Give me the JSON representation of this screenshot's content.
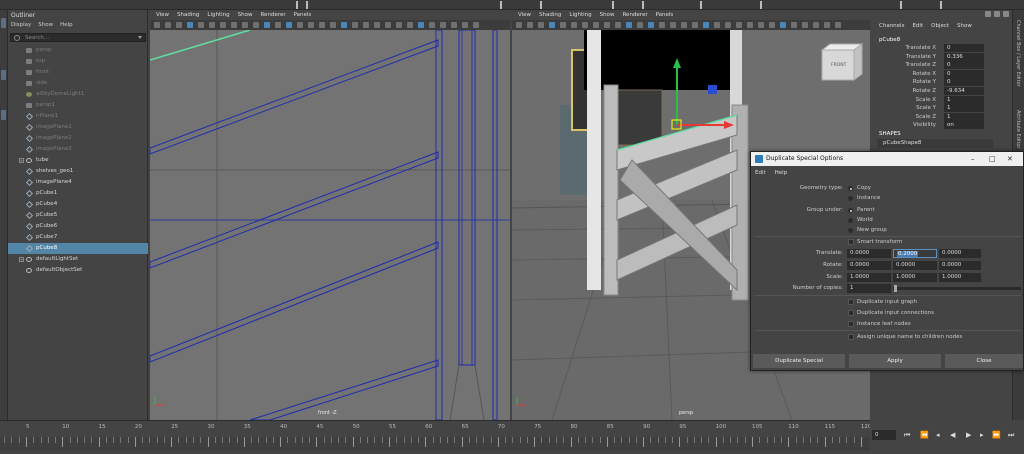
{
  "outliner": {
    "title": "Outliner",
    "menu": [
      "Display",
      "Show",
      "Help"
    ],
    "search_placeholder": "Search...",
    "items": [
      {
        "label": "persp",
        "icon": "camera-icon",
        "dim": true
      },
      {
        "label": "top",
        "icon": "camera-icon",
        "dim": true
      },
      {
        "label": "front",
        "icon": "camera-icon",
        "dim": true
      },
      {
        "label": "side",
        "icon": "camera-icon",
        "dim": true
      },
      {
        "label": "aiSkyDomeLight1",
        "icon": "light-icon",
        "dim": true
      },
      {
        "label": "persp1",
        "icon": "camera-icon",
        "dim": true
      },
      {
        "label": "nPlane1",
        "icon": "mesh-icon",
        "dim": true
      },
      {
        "label": "imagePlane1",
        "icon": "mesh-icon",
        "dim": true
      },
      {
        "label": "imagePlane2",
        "icon": "mesh-icon",
        "dim": true
      },
      {
        "label": "imagePlane3",
        "icon": "mesh-icon",
        "dim": true
      },
      {
        "label": "tube",
        "icon": "group-icon",
        "dim": false,
        "expand": true
      },
      {
        "label": "shelves_geo1",
        "icon": "mesh-icon",
        "dim": false
      },
      {
        "label": "imagePlane4",
        "icon": "mesh-icon",
        "dim": false
      },
      {
        "label": "pCube1",
        "icon": "mesh-icon",
        "dim": false
      },
      {
        "label": "pCube4",
        "icon": "mesh-icon",
        "dim": false
      },
      {
        "label": "pCube5",
        "icon": "mesh-icon",
        "dim": false
      },
      {
        "label": "pCube6",
        "icon": "mesh-icon",
        "dim": false
      },
      {
        "label": "pCube7",
        "icon": "mesh-icon",
        "dim": false
      },
      {
        "label": "pCube8",
        "icon": "mesh-icon",
        "dim": false,
        "selected": true
      },
      {
        "label": "defaultLightSet",
        "icon": "group-icon",
        "dim": false,
        "expand": true
      },
      {
        "label": "defaultObjectSet",
        "icon": "group-icon",
        "dim": false
      }
    ]
  },
  "viewport_front": {
    "menu": [
      "View",
      "Shading",
      "Lighting",
      "Show",
      "Renderer",
      "Panels"
    ],
    "label": "front -Z"
  },
  "viewport_persp": {
    "menu": [
      "View",
      "Shading",
      "Lighting",
      "Show",
      "Renderer",
      "Panels"
    ],
    "label": "persp",
    "viewcube_label": "FRONT"
  },
  "channel_box": {
    "menu": [
      "Channels",
      "Edit",
      "Object",
      "Show"
    ],
    "object": "pCube8",
    "attributes": [
      {
        "name": "Translate X",
        "value": "0"
      },
      {
        "name": "Translate Y",
        "value": "0.336"
      },
      {
        "name": "Translate Z",
        "value": "0"
      },
      {
        "name": "Rotate X",
        "value": "0"
      },
      {
        "name": "Rotate Y",
        "value": "0"
      },
      {
        "name": "Rotate Z",
        "value": "-9.634"
      },
      {
        "name": "Scale X",
        "value": "1"
      },
      {
        "name": "Scale Y",
        "value": "1"
      },
      {
        "name": "Scale Z",
        "value": "1"
      },
      {
        "name": "Visibility",
        "value": "on"
      }
    ],
    "shapes_title": "SHAPES",
    "shape": "pCubeShape8",
    "side_tabs": [
      "Channel Box / Layer Editor",
      "Attribute Editor"
    ]
  },
  "dialog": {
    "title": "Duplicate Special Options",
    "menu": [
      "Edit",
      "Help"
    ],
    "geometry_type_label": "Geometry type:",
    "geometry_options": [
      "Copy",
      "Instance"
    ],
    "group_under_label": "Group under:",
    "group_options": [
      "Parent",
      "World",
      "New group"
    ],
    "smart_transform": "Smart transform",
    "translate_label": "Translate:",
    "translate": [
      "0.0000",
      "0.2000",
      "0.0000"
    ],
    "rotate_label": "Rotate:",
    "rotate": [
      "0.0000",
      "0.0000",
      "0.0000"
    ],
    "scale_label": "Scale:",
    "scale": [
      "1.0000",
      "1.0000",
      "1.0000"
    ],
    "copies_label": "Number of copies:",
    "copies": "1",
    "checks": [
      "Duplicate input graph",
      "Duplicate input connections",
      "Instance leaf nodes"
    ],
    "assign_unique": "Assign unique name to children nodes",
    "buttons": {
      "duplicate": "Duplicate Special",
      "apply": "Apply",
      "close": "Close"
    }
  },
  "timeline": {
    "numbers": [
      "5",
      "10",
      "15",
      "20",
      "25",
      "30",
      "35",
      "40",
      "45",
      "50",
      "55",
      "60",
      "65",
      "70",
      "75",
      "80",
      "85",
      "90",
      "95",
      "100",
      "105",
      "110",
      "115",
      "120"
    ],
    "current_frame": "0"
  }
}
